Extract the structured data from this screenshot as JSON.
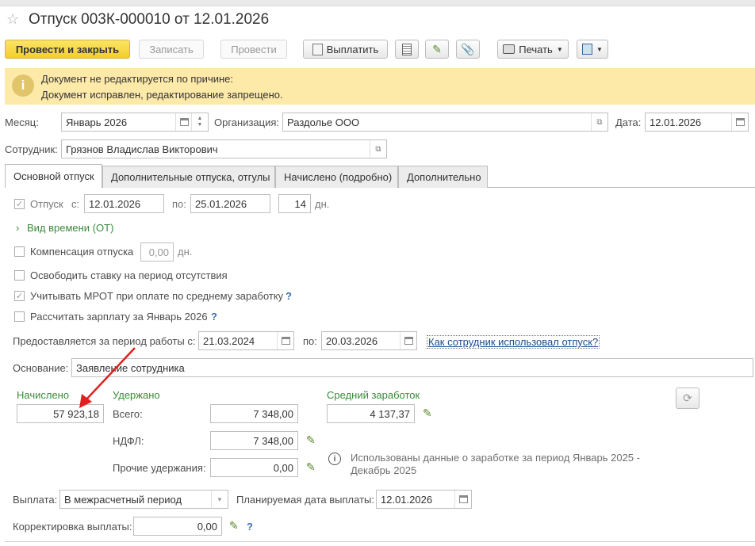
{
  "window": {
    "title": "Отпуск 003К-000010 от 12.01.2026"
  },
  "toolbar": {
    "post_close": "Провести и закрыть",
    "save": "Записать",
    "post": "Провести",
    "pay": "Выплатить",
    "print": "Печать"
  },
  "notice": {
    "line1": "Документ не редактируется по причине:",
    "line2": "Документ исправлен, редактирование запрещено."
  },
  "header": {
    "month_label": "Месяц:",
    "month_value": "Январь 2026",
    "org_label": "Организация:",
    "org_value": "Раздолье ООО",
    "date_label": "Дата:",
    "date_value": "12.01.2026",
    "employee_label": "Сотрудник:",
    "employee_value": "Грязнов Владислав Викторович"
  },
  "tabs": [
    {
      "label": "Основной отпуск",
      "active": true
    },
    {
      "label": "Дополнительные отпуска, отгулы",
      "active": false
    },
    {
      "label": "Начислено (подробно)",
      "active": false
    },
    {
      "label": "Дополнительно",
      "active": false
    }
  ],
  "vacation": {
    "label": "Отпуск",
    "from_label": "с:",
    "from": "12.01.2026",
    "to_label": "по:",
    "to": "25.01.2026",
    "days": "14",
    "days_unit": "дн.",
    "time_kind": "Вид времени (ОТ)"
  },
  "options": {
    "compensation_label": "Компенсация отпуска",
    "compensation_value": "0,00",
    "compensation_unit": "дн.",
    "free_rate": "Освободить ставку на период отсутствия",
    "mrot": "Учитывать МРОТ при оплате по среднему заработку",
    "calc_salary": "Рассчитать зарплату за Январь 2026"
  },
  "work_period": {
    "label": "Предоставляется за период работы с:",
    "from": "21.03.2024",
    "to_label": "по:",
    "to": "20.03.2026",
    "link": "Как сотрудник использовал отпуск?"
  },
  "basis": {
    "label": "Основание:",
    "value": "Заявление сотрудника"
  },
  "totals": {
    "accrued_title": "Начислено",
    "accrued": "57 923,18",
    "withheld_title": "Удержано",
    "total_label": "Всего:",
    "total": "7 348,00",
    "ndfl_label": "НДФЛ:",
    "ndfl": "7 348,00",
    "other_label": "Прочие удержания:",
    "other": "0,00",
    "avg_title": "Средний заработок",
    "avg": "4 137,37",
    "avg_note_1": "Использованы данные о заработке за период Январь 2025 -",
    "avg_note_2": "Декабрь 2025"
  },
  "payment": {
    "label": "Выплата:",
    "value": "В межрасчетный период",
    "date_label": "Планируемая дата выплаты:",
    "date": "12.01.2026",
    "correction_label": "Корректировка выплаты:",
    "correction": "0,00"
  },
  "colors": {
    "accent_yellow": "#f2cf2a",
    "notice_bg": "#fdeaa9",
    "green_label": "#3a8a3a",
    "arrow_red": "#e02020"
  }
}
